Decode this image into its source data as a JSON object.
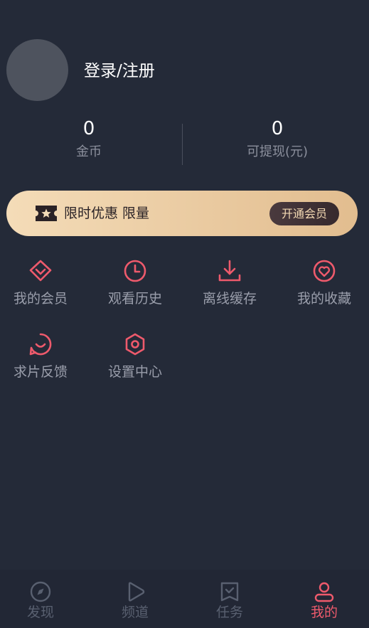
{
  "profile": {
    "login_label": "登录/注册"
  },
  "stats": [
    {
      "value": "0",
      "label": "金币"
    },
    {
      "value": "0",
      "label": "可提现(元)"
    }
  ],
  "vip_banner": {
    "text": "限时优惠 限量",
    "button": "开通会员",
    "colors": {
      "gradient_start": "#f4dcb8",
      "gradient_end": "#e2bd8f",
      "button_bg": "#3e3034",
      "button_text": "#f3d9b3"
    }
  },
  "menu": [
    {
      "label": "我的会员",
      "icon": "diamond-icon"
    },
    {
      "label": "观看历史",
      "icon": "clock-icon"
    },
    {
      "label": "离线缓存",
      "icon": "download-icon"
    },
    {
      "label": "我的收藏",
      "icon": "heart-icon"
    },
    {
      "label": "求片反馈",
      "icon": "feedback-icon"
    },
    {
      "label": "设置中心",
      "icon": "settings-icon"
    }
  ],
  "bottom_nav": [
    {
      "label": "发现",
      "icon": "compass-icon",
      "active": false
    },
    {
      "label": "频道",
      "icon": "play-icon",
      "active": false
    },
    {
      "label": "任务",
      "icon": "task-icon",
      "active": false
    },
    {
      "label": "我的",
      "icon": "user-icon",
      "active": true
    }
  ],
  "colors": {
    "background": "#242a38",
    "accent": "#ee5a6c",
    "muted_text": "#9a9eab",
    "inactive_tab": "#596070"
  }
}
